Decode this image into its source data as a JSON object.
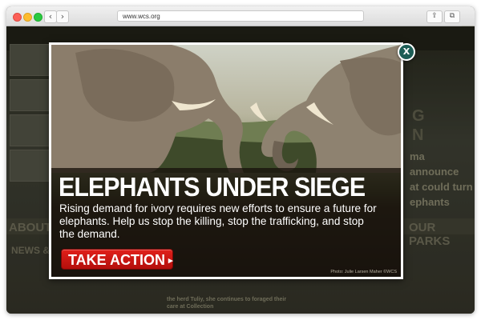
{
  "browser": {
    "url": "www.wcs.org",
    "back_glyph": "‹",
    "forward_glyph": "›",
    "share_glyph": "⇪",
    "tabs_glyph": "⧉",
    "new_tab_glyph": "+"
  },
  "background_site": {
    "about_label": "ABOUT U",
    "news_label": "NEWS & F",
    "parks_label": "OUR PARKS",
    "headline_fragment_1": "G",
    "headline_fragment_2": "N",
    "body_fragment_1": "ma announce",
    "body_fragment_2": "at could turn",
    "body_fragment_3": "ephants",
    "bottom_fragment": "the herd Tuliy, she continues to foraged their care at Collection"
  },
  "modal": {
    "headline": "ELEPHANTS UNDER SIEGE",
    "body": "Rising demand for ivory requires new efforts to ensure a future for elephants. Help us stop the killing, stop the trafficking, and stop the demand.",
    "cta_label": "TAKE ACTION",
    "cta_arrow": "▸",
    "photo_credit": "Photo: Julie Larsen Maher ©WCS",
    "close_glyph": "X"
  },
  "colors": {
    "cta_red": "#c8150f",
    "close_teal": "#1c5d55",
    "caption_overlay": "#18120c"
  }
}
